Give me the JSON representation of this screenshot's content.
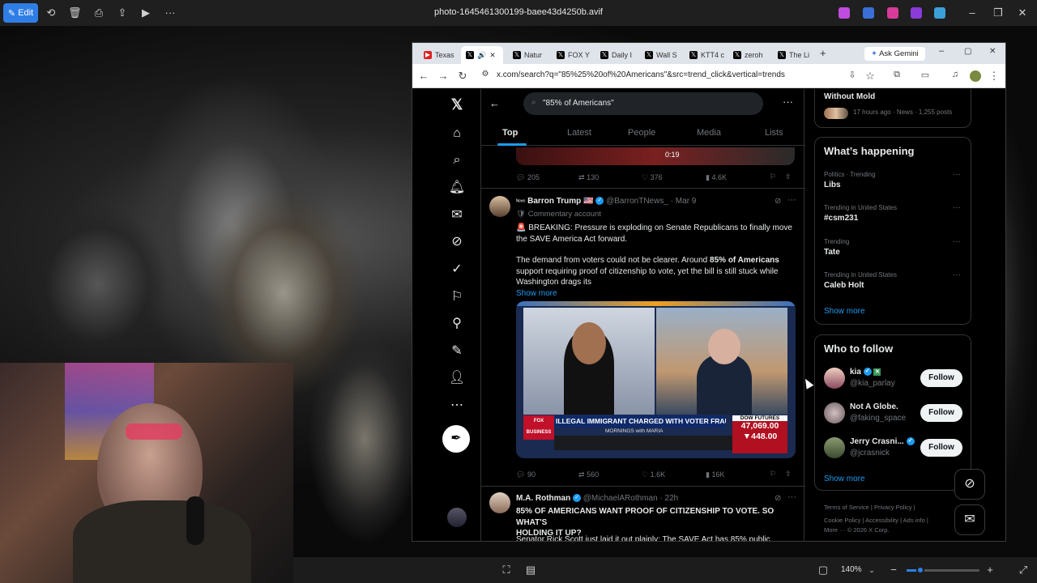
{
  "viewer": {
    "edit_label": "Edit",
    "filename": "photo-1645461300199-baee43d4250b.avif",
    "zoom": "140%"
  },
  "browser": {
    "tabs": [
      "Texas",
      "",
      "Natur",
      "FOX Y",
      "Daily I",
      "Wall S",
      "KTT4 c",
      "zeroh",
      "The Li"
    ],
    "ask_gemini": "Ask Gemini",
    "url": "x.com/search?q=\"85%25%20of%20Americans\"&src=trend_click&vertical=trends"
  },
  "x": {
    "search_value": "\"85% of Americans\"",
    "tabs": [
      "Top",
      "Latest",
      "People",
      "Media",
      "Lists"
    ],
    "prev_tweet": {
      "video_time": "0:19",
      "replies": "205",
      "reposts": "130",
      "likes": "376",
      "views": "4.6K"
    },
    "tweet1": {
      "name": "Barron Trump 🇺🇸",
      "name_prefix": "ᴺᵉʷˢ",
      "handle": "@BarronTNews_",
      "date": "· Mar 9",
      "label": "Commentary account",
      "line1": "🚨 BREAKING: Pressure is exploding on Senate Republicans to finally move",
      "line2": "the SAVE America Act forward.",
      "line3a": "The demand from voters could not be clearer. Around ",
      "line3b": "85% of Americans",
      "line4": "support requiring proof of citizenship to vote, yet the bill is still stuck while",
      "line5": "Washington drags its",
      "show_more": "Show more",
      "img_chyron": "ILLEGAL IMMIGRANT CHARGED WITH VOTER FRAUD",
      "img_show": "MORNINGS with MARIA",
      "img_dow_label": "DOW FUTURES",
      "img_dow1": "47,069.00",
      "img_dow2": "448.00",
      "img_network": "FOX BUSINESS",
      "replies": "90",
      "reposts": "560",
      "likes": "1.6K",
      "views": "16K"
    },
    "tweet2": {
      "name": "M.A. Rothman",
      "handle": "@MichaelARothman",
      "date": "· 22h",
      "line1": "85% OF AMERICANS WANT PROOF OF CITIZENSHIP TO VOTE. SO WHAT'S",
      "line2": "HOLDING IT UP?",
      "line3": "Senator Rick Scott just laid it out plainly: The SAVE Act has 85% public"
    },
    "right": {
      "prev_title": "Without Mold",
      "prev_meta": "17 hours ago · News · 1,255 posts",
      "happening_title": "What’s happening",
      "trends": [
        {
          "cat": "Politics · Trending",
          "name": "Libs"
        },
        {
          "cat": "Trending in United States",
          "name": "#csm231"
        },
        {
          "cat": "Trending",
          "name": "Tate"
        },
        {
          "cat": "Trending in United States",
          "name": "Caleb Holt"
        }
      ],
      "show_more": "Show more",
      "wtf_title": "Who to follow",
      "follow": [
        {
          "name": "kia",
          "handle": "@kia_parlay"
        },
        {
          "name": "Not A Globe.",
          "handle": "@faking_space"
        },
        {
          "name": "Jerry Crasni...",
          "handle": "@jcrasnick"
        }
      ],
      "follow_label": "Follow",
      "footer_line1": "Terms of Service  |  Privacy Policy  |",
      "footer_line2": "Cookie Policy  |  Accessibility  |  Ads info  |",
      "footer_line3": "More ···  © 2026 X Corp."
    }
  },
  "colors": {
    "accent": "#1d9bf0",
    "viewer_edit": "#2f7ee6"
  }
}
